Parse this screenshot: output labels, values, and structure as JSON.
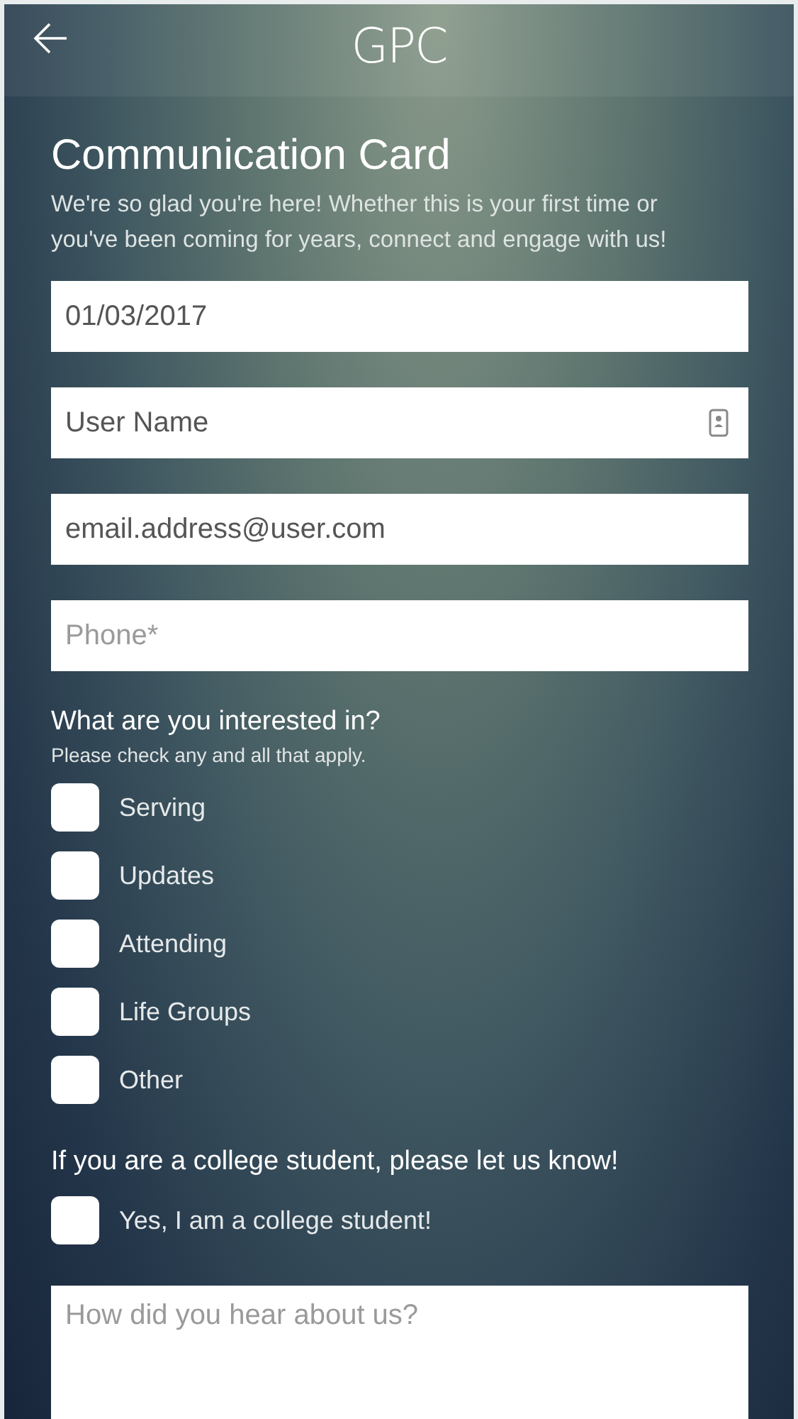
{
  "header": {
    "title": "GPC"
  },
  "card": {
    "title": "Communication Card",
    "intro": "We're so glad you're here! Whether this is your first time or you've been coming for years, connect and engage with us!"
  },
  "fields": [
    {
      "kind": "text",
      "value": "01/03/2017"
    },
    {
      "kind": "contact",
      "value": "User Name"
    },
    {
      "kind": "text",
      "value": "email.address@user.com"
    },
    {
      "kind": "text",
      "placeholder": "Phone*"
    }
  ],
  "interests": {
    "heading": "What are you interested in?",
    "hint": "Please check any and all that apply.",
    "options": [
      {
        "label": "Serving",
        "checked": false
      },
      {
        "label": "Updates",
        "checked": false
      },
      {
        "label": "Attending",
        "checked": false
      },
      {
        "label": "Life Groups",
        "checked": false
      },
      {
        "label": "Other",
        "checked": false
      }
    ]
  },
  "college": {
    "heading": "If you are a college student, please let us know!",
    "options": [
      {
        "label": "Yes, I am a college student!",
        "checked": false
      }
    ]
  },
  "referral": {
    "placeholder": "How did you hear about us?"
  }
}
